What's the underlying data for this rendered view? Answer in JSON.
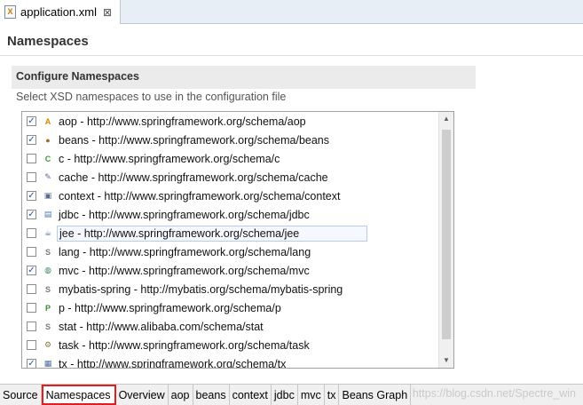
{
  "editor_tab": {
    "title": "application.xml",
    "close": "⊠"
  },
  "page": {
    "title": "Namespaces"
  },
  "section": {
    "title": "Configure Namespaces",
    "description": "Select XSD namespaces to use in the configuration file"
  },
  "namespaces": [
    {
      "label": "aop - http://www.springframework.org/schema/aop",
      "checked": true,
      "icon": "aop-icon",
      "glyph": "A",
      "color": "#d08a00"
    },
    {
      "label": "beans - http://www.springframework.org/schema/beans",
      "checked": true,
      "icon": "beans-icon",
      "glyph": "●",
      "color": "#a0702a"
    },
    {
      "label": "c - http://www.springframework.org/schema/c",
      "checked": false,
      "icon": "c-icon",
      "glyph": "C",
      "color": "#3a9a3a"
    },
    {
      "label": "cache - http://www.springframework.org/schema/cache",
      "checked": false,
      "icon": "cache-icon",
      "glyph": "✎",
      "color": "#6a5a9a"
    },
    {
      "label": "context - http://www.springframework.org/schema/context",
      "checked": true,
      "icon": "context-icon",
      "glyph": "▣",
      "color": "#5a6a8a"
    },
    {
      "label": "jdbc - http://www.springframework.org/schema/jdbc",
      "checked": true,
      "icon": "jdbc-icon",
      "glyph": "▤",
      "color": "#4a7ab0"
    },
    {
      "label": "jee - http://www.springframework.org/schema/jee",
      "checked": false,
      "icon": "jee-icon",
      "glyph": "☕",
      "color": "#4a6ab0",
      "selected": true
    },
    {
      "label": "lang - http://www.springframework.org/schema/lang",
      "checked": false,
      "icon": "lang-icon",
      "glyph": "S",
      "color": "#7a7a7a"
    },
    {
      "label": "mvc - http://www.springframework.org/schema/mvc",
      "checked": true,
      "icon": "mvc-icon",
      "glyph": "◍",
      "color": "#3a8a5a"
    },
    {
      "label": "mybatis-spring - http://mybatis.org/schema/mybatis-spring",
      "checked": false,
      "icon": "mybatis-icon",
      "glyph": "S",
      "color": "#7a7a7a"
    },
    {
      "label": "p - http://www.springframework.org/schema/p",
      "checked": false,
      "icon": "p-icon",
      "glyph": "P",
      "color": "#3a8a3a"
    },
    {
      "label": "stat - http://www.alibaba.com/schema/stat",
      "checked": false,
      "icon": "stat-icon",
      "glyph": "S",
      "color": "#7a7a7a"
    },
    {
      "label": "task - http://www.springframework.org/schema/task",
      "checked": false,
      "icon": "task-icon",
      "glyph": "⚙",
      "color": "#8a7a3a"
    },
    {
      "label": "tx - http://www.springframework.org/schema/tx",
      "checked": true,
      "icon": "tx-icon",
      "glyph": "▦",
      "color": "#4a6a9a"
    }
  ],
  "bottom_tabs": [
    {
      "label": "Source",
      "active": false
    },
    {
      "label": "Namespaces",
      "active": true
    },
    {
      "label": "Overview",
      "active": false
    },
    {
      "label": "aop",
      "active": false
    },
    {
      "label": "beans",
      "active": false
    },
    {
      "label": "context",
      "active": false
    },
    {
      "label": "jdbc",
      "active": false
    },
    {
      "label": "mvc",
      "active": false
    },
    {
      "label": "tx",
      "active": false
    },
    {
      "label": "Beans Graph",
      "active": false
    }
  ],
  "watermark": "https://blog.csdn.net/Spectre_win",
  "colors": {
    "highlight_outline": "#e02020",
    "check": "#1f4fa0"
  }
}
